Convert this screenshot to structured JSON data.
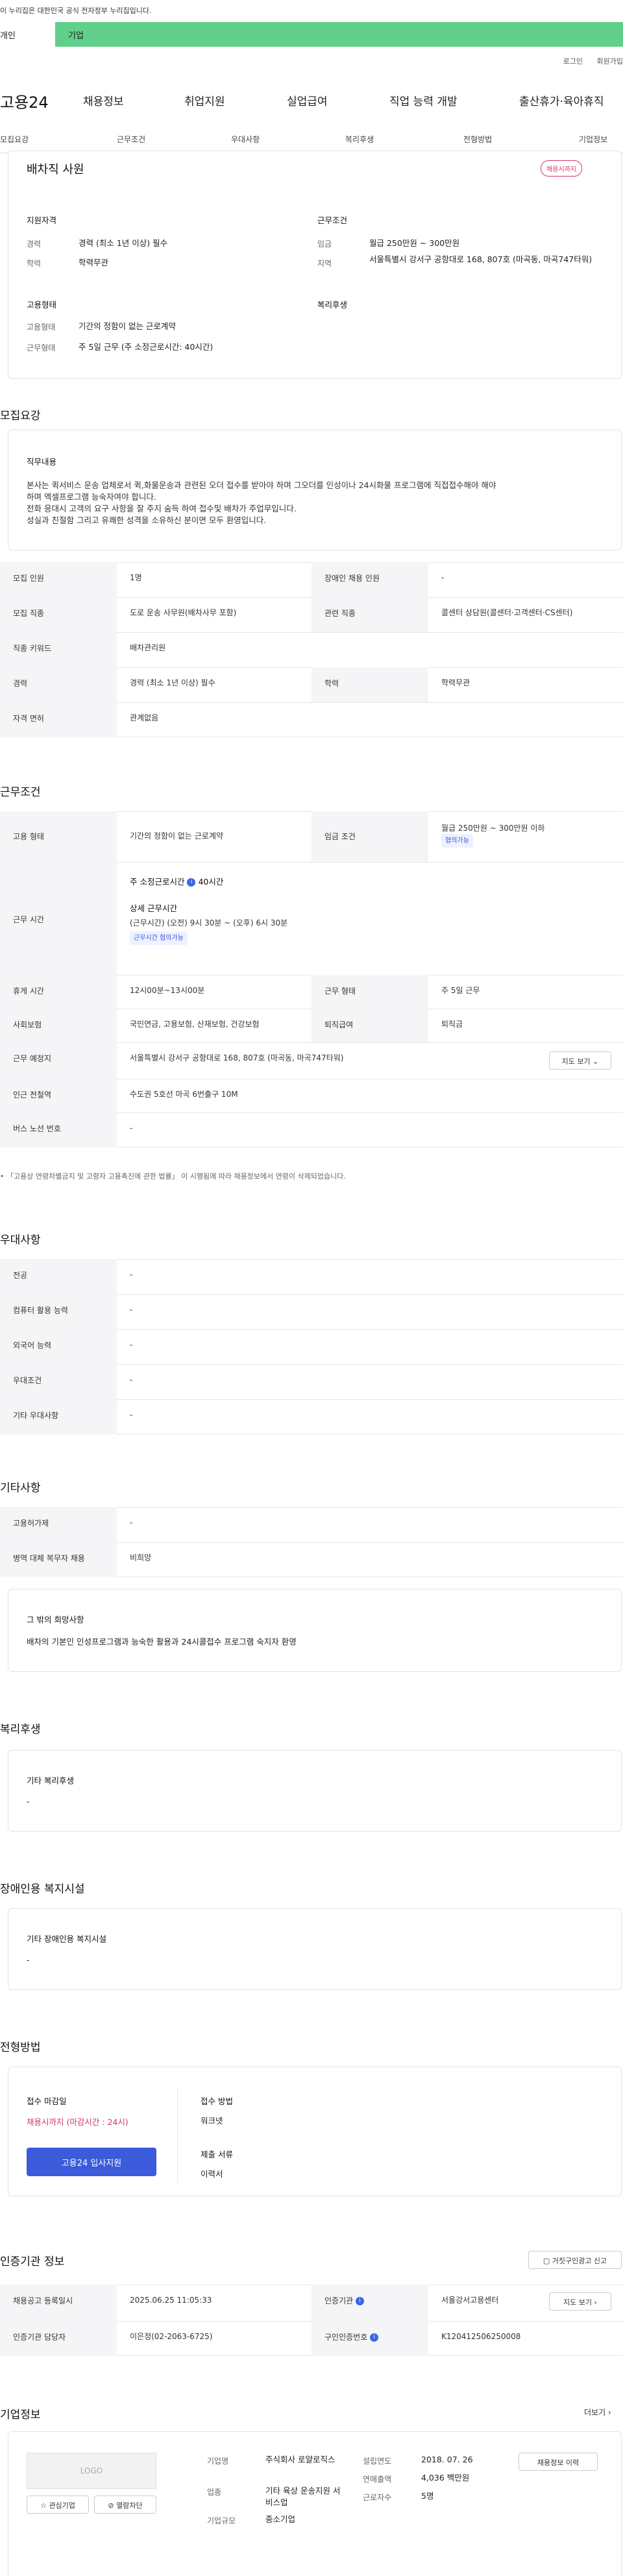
{
  "gov_banner": "이 누리집은 대한민국 공식 전자정부 누리집입니다.",
  "top_tabs": {
    "left": "개인",
    "right": "기업"
  },
  "util": [
    "로그인",
    "회원가입"
  ],
  "gnb": {
    "logo": "고용24",
    "menu": [
      "채용정보",
      "취업지원",
      "실업급여",
      "직업 능력 개발",
      "출산휴가·육아휴직"
    ]
  },
  "snb": [
    "모집요강",
    "근무조건",
    "우대사항",
    "복리후생",
    "전형방법",
    "기업정보"
  ],
  "summary": {
    "title": "배차직 사원",
    "badge": "채용시까지",
    "qual_title": "지원자격",
    "career_lbl": "경력",
    "career_val": "경력 (최소 1년 이상) 필수",
    "edu_lbl": "학력",
    "edu_val": "학력무관",
    "cond_title": "근무조건",
    "wage_lbl": "임금",
    "wage_val": "월급 250만원 ~ 300만원",
    "area_lbl": "지역",
    "area_val": "서울특별시 강서구 공항대로 168, 807호 (마곡동, 마곡747타워)",
    "emp_title": "고용형태",
    "emp_lbl": "고용형태",
    "emp_val": "기간의 정함이 없는 근로계약",
    "work_lbl": "근무형태",
    "work_val": "주 5일 근무 (주 소정근로시간: 40시간)",
    "welfare_title": "복리후생"
  },
  "recruit": {
    "title": "모집요강",
    "job_title": "직무내용",
    "job_lines": [
      "본사는 퀵서비스 운송 업체로서 퀵,화물운송과 관련된 오더 접수를 받아야 하며 그오더를 인성이나 24시화물 프로그램에 직접접수해야 해야",
      "하며 엑셀프로그램 능숙자여야 합니다.",
      "전화 응대시  고객의 요구 사항을 잘 주지 숨득 하여 접수및  배차가   주업무입니다.",
      "성실과 친절함 그리고  유쾌한 성격을 소유하신 분이면 모두 환영입니다."
    ],
    "rows": [
      [
        "모집 인원",
        "1명",
        "장애인 채용 인원",
        "-"
      ],
      [
        "모집 직종",
        "도로 운송 사무원(배차사무 포함)",
        "관련 직종",
        "콜센터 상담원(콜센터·고객센터·CS센터)"
      ],
      [
        "직종 키워드",
        "배차관리원",
        "",
        ""
      ],
      [
        "경력",
        "경력 (최소 1년 이상) 필수",
        "학력",
        "학력무관"
      ],
      [
        "자격 면허",
        "관계없음",
        "",
        ""
      ]
    ]
  },
  "work": {
    "title": "근무조건",
    "emp_lbl": "고용 형태",
    "emp_val": "기간의 정함이 없는 근로계약",
    "wage_lbl": "임금 조건",
    "wage_val": "월급 250만원 ~ 300만원 이하",
    "wage_tag": "협의가능",
    "time_lbl": "근무 시간",
    "weekly": "주 소정근로시간",
    "weekly_val": "40시간",
    "detail_title": "상세 근무시간",
    "detail_val": "(근무시간) (오전) 9시 30분 ~ (오후) 6시 30분",
    "detail_tag": "근무시간 협의가능",
    "rest_lbl": "휴게 시간",
    "rest_val": "12시00분~13시00분",
    "form_lbl": "근무 형태",
    "form_val": "주 5일 근무",
    "ins_lbl": "사회보험",
    "ins_val": "국민연금, 고용보험, 산재보험, 건강보험",
    "ret_lbl": "퇴직급여",
    "ret_val": "퇴직금",
    "place_lbl": "근무 예정지",
    "place_val": "서울특별시 강서구 공항대로 168, 807호 (마곡동, 마곡747타워)",
    "map_btn": "지도 보기",
    "sub_lbl": "인근 전철역",
    "sub_val": "수도권 5호선 마곡 6번출구 10M",
    "bus_lbl": "버스 노선 번호",
    "bus_val": "-",
    "note": "「고용상 연령차별금지 및 고령자 고용촉진에 관한 법률」 이 시행됨에 따라 채용정보에서 연령이 삭제되었습니다."
  },
  "pref": {
    "title": "우대사항",
    "rows": [
      [
        "전공",
        "-"
      ],
      [
        "컴퓨터 활용 능력",
        "-"
      ],
      [
        "외국어 능력",
        "-"
      ],
      [
        "우대조건",
        "-"
      ],
      [
        "기타 우대사항",
        "-"
      ]
    ]
  },
  "etc": {
    "title": "기타사항",
    "rows": [
      [
        "고용허가제",
        "-"
      ],
      [
        "병역 대체 복무자 채용",
        "비희망"
      ]
    ],
    "wish_title": "그 밖의 희망사항",
    "wish_val": "배차의 기본인 인성프로그램과 능숙한 활용과  24시콜접수 프로그램 숙지자 환영"
  },
  "welfare": {
    "title": "복리후생",
    "sub": "기타 복리후생",
    "val": "-"
  },
  "disab": {
    "title": "장애인용 복지시설",
    "sub": "기타 장애인용 복지시설",
    "val": "-"
  },
  "screen": {
    "title": "전형방법",
    "deadline_lbl": "접수 마감일",
    "deadline_val": "채용시까지 (마감시간 : 24시)",
    "apply_btn": "고용24 입사지원",
    "method_lbl": "접수 방법",
    "method_val": "워크넷",
    "docs_lbl": "제출 서류",
    "docs_val": "이력서"
  },
  "agency": {
    "title": "인증기관 정보",
    "report_btn": "거짓구인광고 신고",
    "reg_lbl": "채용공고 등록일시",
    "reg_val": "2025.06.25 11:05:33",
    "org_lbl": "인증기관",
    "org_val": "서울강서고용센터",
    "map_btn": "지도 보기",
    "mgr_lbl": "인증기관 담당자",
    "mgr_val": "이은정(02-2063-6725)",
    "no_lbl": "구인인증번호",
    "no_val": "K120412506250008"
  },
  "company": {
    "title": "기업정보",
    "more": "더보기",
    "logo": "LOGO",
    "fav_btn": "관심기업",
    "block_btn": "열람차단",
    "name_lbl": "기업명",
    "name_val": "주식회사 로얄로직스",
    "ind_lbl": "업종",
    "ind_val": "기타 육상 운송지원 서비스업",
    "size_lbl": "기업규모",
    "size_val": "중소기업",
    "est_lbl": "설립연도",
    "est_val": "2018. 07. 26",
    "sales_lbl": "연매출액",
    "sales_val": "4,036 백만원",
    "staff_lbl": "근로자수",
    "staff_val": "5명",
    "list_btn": "채용정보 이력"
  },
  "colors": {
    "green": "#5fcf8a",
    "blue": "#3b5bdb",
    "red": "#d6336c"
  }
}
